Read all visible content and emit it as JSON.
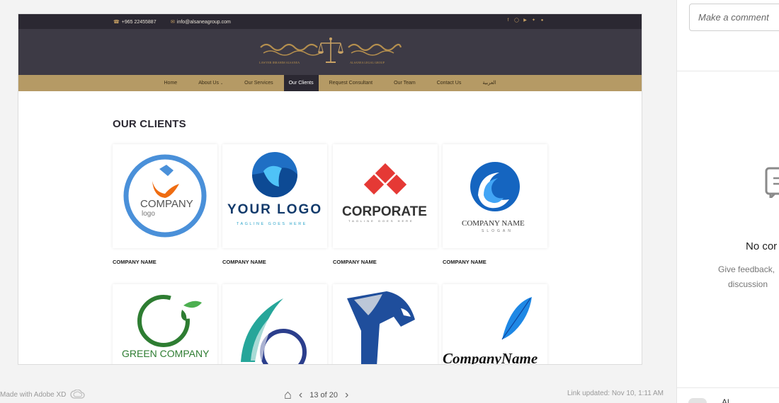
{
  "site": {
    "phone": "+965 22455887",
    "email": "info@alsaneagroup.com",
    "social_icons": [
      "facebook-icon",
      "instagram-icon",
      "youtube-icon",
      "twitter-icon",
      "whatsapp-icon"
    ],
    "logo_left_en": "LAWYER IBRAHIM ALSANEA",
    "logo_right_en": "ALSANEA LEGAL GROUP",
    "nav": [
      {
        "label": "Home"
      },
      {
        "label": "About Us",
        "dropdown": true
      },
      {
        "label": "Our Services"
      },
      {
        "label": "Our Clients",
        "active": true
      },
      {
        "label": "Request Consultant"
      },
      {
        "label": "Our Team"
      },
      {
        "label": "Contact Us"
      },
      {
        "label": "العربية"
      }
    ],
    "page_title": "OUR CLIENTS",
    "clients": [
      {
        "logo_text": "COMPANY",
        "logo_sub": "logo",
        "caption": "COMPANY NAME"
      },
      {
        "logo_text": "YOUR LOGO",
        "logo_sub": "TAGLINE GOES HERE",
        "caption": "COMPANY NAME"
      },
      {
        "logo_text": "CORPORATE",
        "logo_sub": "TAGLINE GOES HERE",
        "caption": "COMPANY NAME"
      },
      {
        "logo_text": "COMPANY NAME",
        "logo_sub": "SLOGAN",
        "caption": "COMPANY NAME"
      },
      {
        "logo_text": "GREEN COMPANY",
        "logo_sub": "",
        "caption": ""
      },
      {
        "logo_text": "",
        "logo_sub": "",
        "caption": ""
      },
      {
        "logo_text": "",
        "logo_sub": "",
        "caption": ""
      },
      {
        "logo_text": "CompanyName",
        "logo_sub": "",
        "caption": ""
      }
    ]
  },
  "viewer": {
    "made_with": "Made with Adobe XD",
    "page_indicator": "13 of 20",
    "link_updated": "Link updated: Nov 10, 1:11 AM"
  },
  "comments": {
    "placeholder": "Make a comment",
    "empty_title": "No cor",
    "hint_line1": "Give feedback,",
    "hint_line2": "discussion",
    "toggle_label": "Al"
  },
  "colors": {
    "nav_bg": "#b59a65",
    "header_bg": "#3d3a45",
    "topbar_bg": "#2b2832",
    "gold": "#c9a264"
  }
}
